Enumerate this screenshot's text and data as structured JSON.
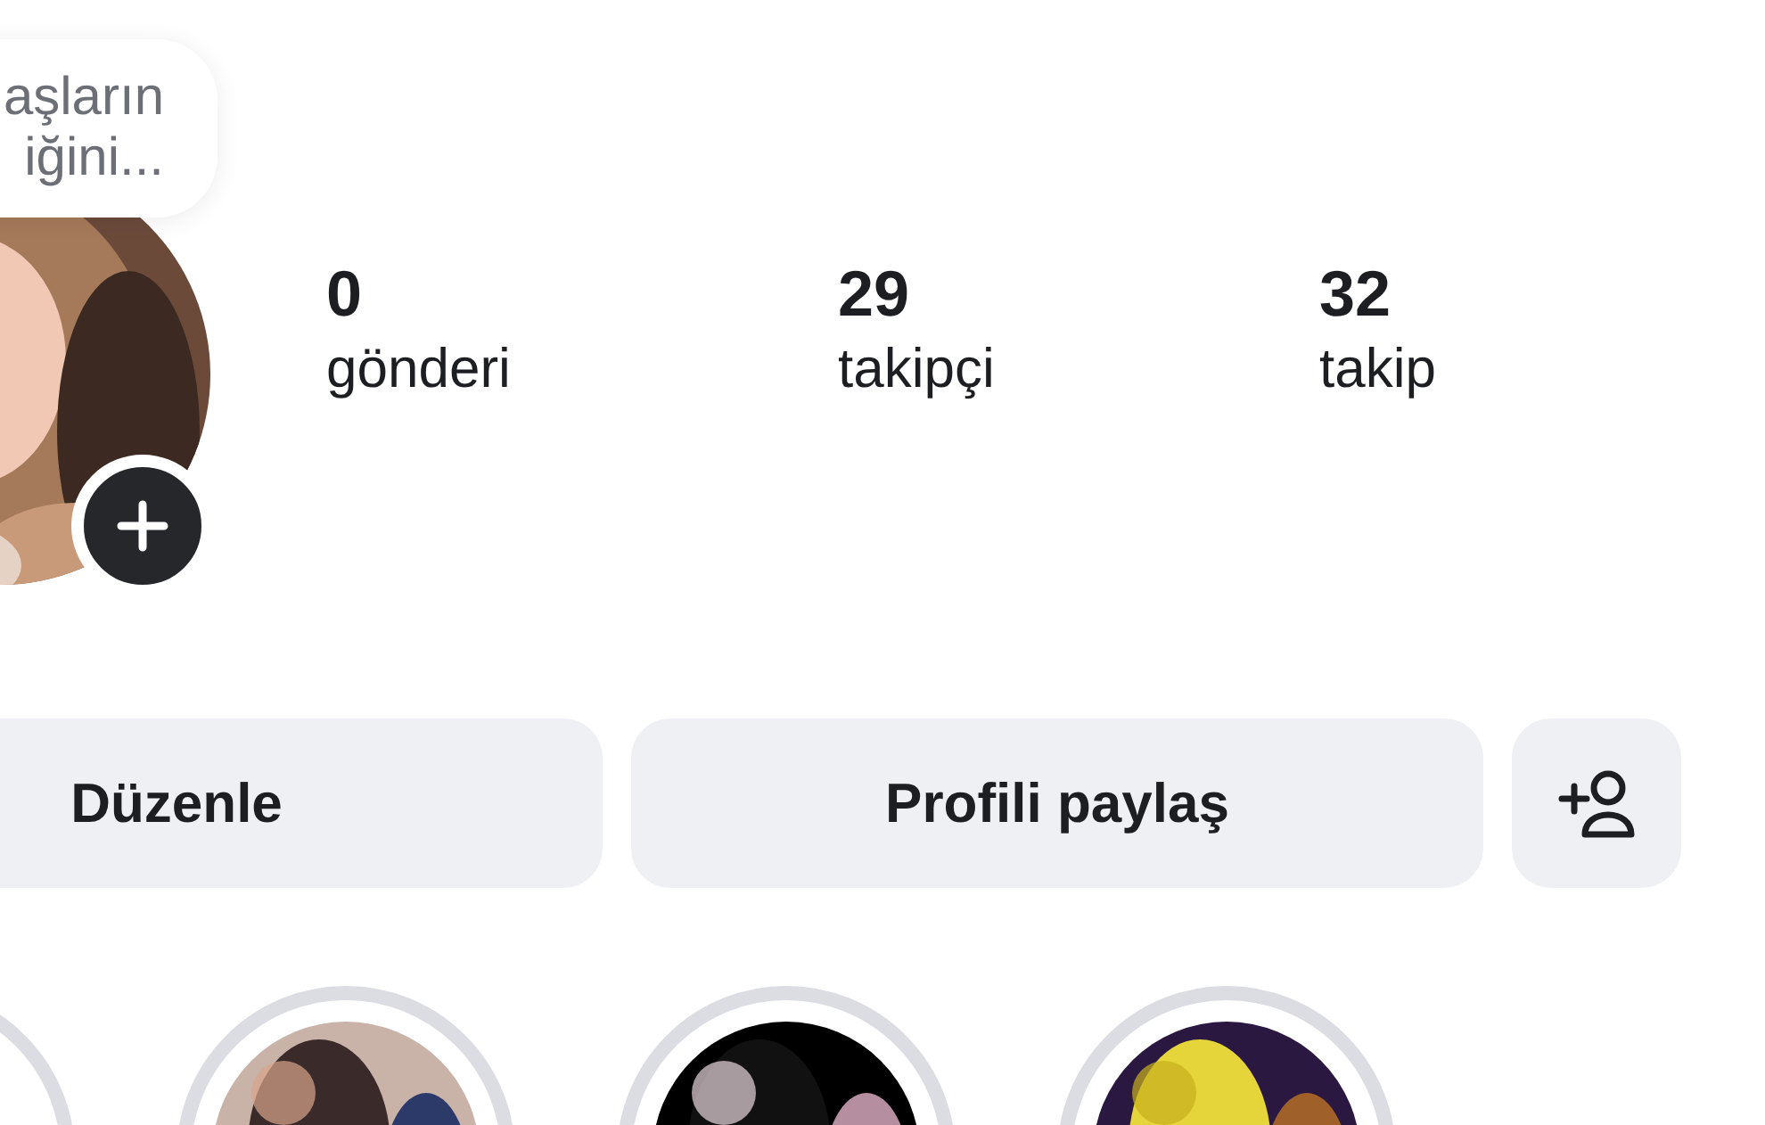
{
  "note": {
    "text": "aşların iğini..."
  },
  "stats": [
    {
      "value": "0",
      "label": "gönderi"
    },
    {
      "value": "29",
      "label": "takipçi"
    },
    {
      "value": "32",
      "label": "takip"
    }
  ],
  "buttons": [
    {
      "kind": "text",
      "label": "Düzenle"
    },
    {
      "kind": "text",
      "label": "Profili paylaş"
    },
    {
      "kind": "add-person"
    }
  ],
  "highlights": [
    {
      "kind": "empty"
    },
    {
      "kind": "picture"
    },
    {
      "kind": "picture"
    },
    {
      "kind": "picture"
    }
  ]
}
